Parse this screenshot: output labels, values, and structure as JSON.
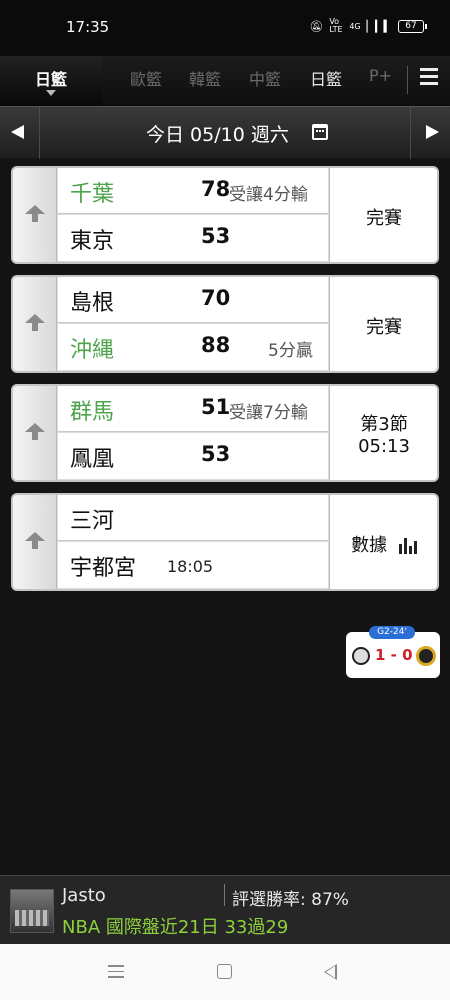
{
  "status_bar": {
    "time": "17:35",
    "network": "4G",
    "volte": "Vo LTE",
    "battery": "67"
  },
  "tabs": {
    "main": "日籃",
    "items": [
      {
        "label": "歐籃"
      },
      {
        "label": "韓籃"
      },
      {
        "label": "中籃"
      },
      {
        "label": "日籃"
      },
      {
        "label": "P+"
      }
    ]
  },
  "date_bar": {
    "label": "今日 05/10 週六"
  },
  "games": [
    {
      "home": {
        "name": "千葉",
        "score": "78",
        "note": "受讓4分輸",
        "winner": true
      },
      "away": {
        "name": "東京",
        "score": "53"
      },
      "status": "完賽"
    },
    {
      "home": {
        "name": "島根",
        "score": "70"
      },
      "away": {
        "name": "沖縄",
        "score": "88",
        "note": "5分贏",
        "winner": true
      },
      "status": "完賽"
    },
    {
      "home": {
        "name": "群馬",
        "score": "51",
        "note": "受讓7分輸",
        "winner": true
      },
      "away": {
        "name": "鳳凰",
        "score": "53"
      },
      "status_line1": "第3節",
      "status_line2": "05:13"
    },
    {
      "home": {
        "name": "三河"
      },
      "away": {
        "name": "宇都宮",
        "time": "18:05"
      },
      "status": "數據"
    }
  ],
  "widget": {
    "period": "G2-24'",
    "score": "1 - 0"
  },
  "banner": {
    "user": "Jasto",
    "win_rate": "評選勝率: 87%",
    "record": "NBA 國際盤近21日 33過29"
  },
  "colors": {
    "winner": "#4fa34c",
    "record": "#8ed13c",
    "live_score": "#d0212b",
    "pill": "#2a6fd6"
  }
}
